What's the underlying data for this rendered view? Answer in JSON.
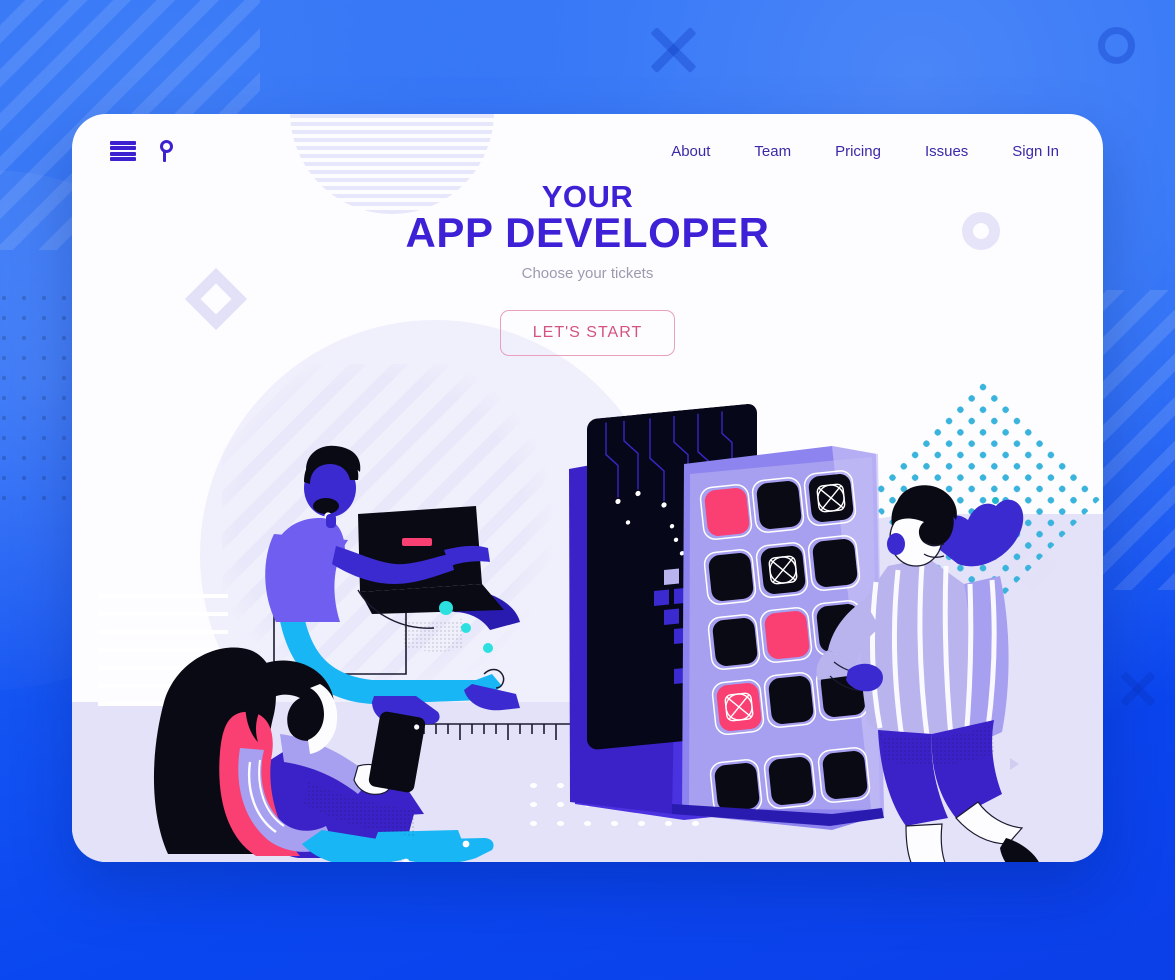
{
  "page": {
    "background_color": "#0a47f0",
    "card_color": "#fdfdff"
  },
  "header": {
    "menu_icon": "hamburger-menu-icon",
    "search_icon": "search-icon",
    "nav": [
      {
        "label": "About"
      },
      {
        "label": "Team"
      },
      {
        "label": "Pricing"
      },
      {
        "label": "Issues"
      },
      {
        "label": "Sign In"
      }
    ]
  },
  "hero": {
    "title_line1": "YOUR",
    "title_line2": "APP DEVELOPER",
    "subtitle": "Choose your tickets",
    "cta_label": "LET'S START",
    "title_color": "#3d21d6",
    "subtitle_color": "#9b9bb0",
    "cta_border_color": "#e8a0bb",
    "cta_text_color": "#d4537f"
  },
  "illustration": {
    "name": "app-developer-illustration",
    "characters": [
      {
        "name": "woman-sitting-with-phone",
        "description": "woman with long black hair seated, holding smartphone, pink top, lavender sleeve, blue shorts, blue sneakers"
      },
      {
        "name": "man-with-laptop",
        "description": "man seated with laptop on knees, purple jacket, cyan trousers, dark blue shoes"
      },
      {
        "name": "woman-standing-waving",
        "description": "woman in striped lavender coat with raised arm, blue shorts, black heels"
      }
    ],
    "devices": [
      {
        "name": "back-phone-circuit-screen",
        "screen": "dark circuit-board pattern with pixel blocks"
      },
      {
        "name": "front-phone-app-grid",
        "screen": "lavender phone showing a grid of app tiles"
      }
    ],
    "app_grid": {
      "rows": 4,
      "cols": 3,
      "dock_count": 3,
      "tiles": [
        {
          "row": 1,
          "col": 1,
          "color": "#fa3f72",
          "glyph": "none"
        },
        {
          "row": 1,
          "col": 2,
          "color": "#0a0a14",
          "glyph": "none"
        },
        {
          "row": 1,
          "col": 3,
          "color": "#0a0a14",
          "glyph": "circle-x-icon"
        },
        {
          "row": 2,
          "col": 1,
          "color": "#0a0a14",
          "glyph": "none"
        },
        {
          "row": 2,
          "col": 2,
          "color": "#0a0a14",
          "glyph": "circle-x-icon"
        },
        {
          "row": 2,
          "col": 3,
          "color": "#0a0a14",
          "glyph": "none"
        },
        {
          "row": 3,
          "col": 1,
          "color": "#0a0a14",
          "glyph": "none"
        },
        {
          "row": 3,
          "col": 2,
          "color": "#fa3f72",
          "glyph": "none"
        },
        {
          "row": 3,
          "col": 3,
          "color": "#0a0a14",
          "glyph": "none"
        },
        {
          "row": 4,
          "col": 1,
          "color": "#fa3f72",
          "glyph": "circle-x-icon"
        },
        {
          "row": 4,
          "col": 2,
          "color": "#0a0a14",
          "glyph": "none"
        },
        {
          "row": 4,
          "col": 3,
          "color": "#0a0a14",
          "glyph": "none"
        }
      ]
    },
    "decorations": [
      {
        "name": "dotted-diamond",
        "color": "#3ab4dd"
      },
      {
        "name": "lavender-diamond-outline",
        "color": "#e2e1f7"
      },
      {
        "name": "donut-shape",
        "color": "#e5e4f8"
      },
      {
        "name": "striped-semicircle",
        "color": "#e7e7fb"
      },
      {
        "name": "floor-dots",
        "color": "#ffffff"
      },
      {
        "name": "ruler-marks",
        "color": "#1a1a2e"
      }
    ]
  },
  "background_decorations": [
    {
      "name": "diagonal-stripes-top-left"
    },
    {
      "name": "diagonal-stripes-right"
    },
    {
      "name": "dot-grid-left"
    },
    {
      "name": "ring-top-right"
    },
    {
      "name": "x-mark-top-center"
    },
    {
      "name": "x-mark-bottom-right"
    }
  ]
}
